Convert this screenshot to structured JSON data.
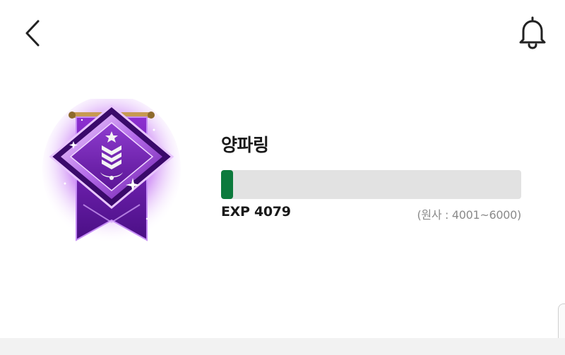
{
  "header": {
    "back_icon": "chevron-left-icon",
    "notification_icon": "bell-icon"
  },
  "rank": {
    "name": "양파링",
    "badge_icon": "purple-rank-badge",
    "exp_label": "EXP 4079",
    "range_label": "(원사 : 4001~6000)",
    "progress": 0.04,
    "progress_color": "#0c7a3c",
    "track_color": "#e2e2e2"
  },
  "colors": {
    "badge_primary": "#7a1fc0",
    "badge_glow": "#c860ff"
  }
}
